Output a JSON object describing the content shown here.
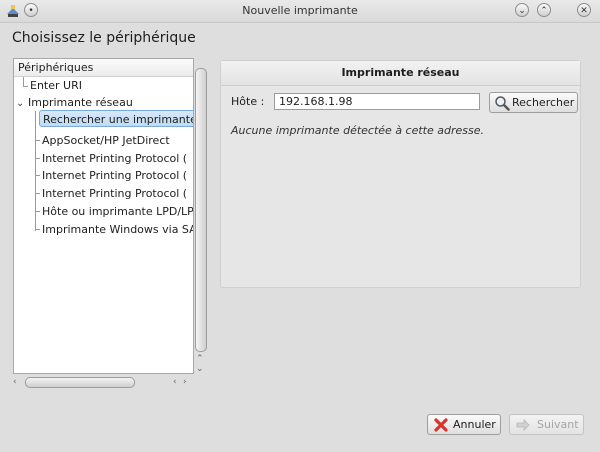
{
  "window": {
    "title": "Nouvelle imprimante",
    "minimize_icon": "chevron-down-icon",
    "maximize_icon": "chevron-up-icon",
    "close_icon": "close-icon"
  },
  "page": {
    "heading": "Choisissez le périphérique"
  },
  "tree": {
    "header": "Périphériques",
    "items": [
      {
        "label": "Enter URI",
        "level": 0
      },
      {
        "label": "Imprimante réseau",
        "level": 0,
        "expanded": true
      },
      {
        "label": "Rechercher une imprimante",
        "level": 1,
        "selected": true
      },
      {
        "label": "AppSocket/HP JetDirect",
        "level": 1
      },
      {
        "label": "Internet Printing Protocol (",
        "level": 1
      },
      {
        "label": "Internet Printing Protocol (",
        "level": 1
      },
      {
        "label": "Internet Printing Protocol (",
        "level": 1
      },
      {
        "label": "Hôte ou imprimante LPD/LP",
        "level": 1
      },
      {
        "label": "Imprimante Windows via SA",
        "level": 1
      }
    ]
  },
  "details": {
    "title": "Imprimante réseau",
    "host_label": "Hôte :",
    "host_value": "192.168.1.98",
    "search_button": "Rechercher",
    "notice": "Aucune imprimante détectée à cette adresse."
  },
  "footer": {
    "cancel_button": "Annuler",
    "next_button": "Suivant",
    "next_enabled": false
  },
  "colors": {
    "selection": "#c2dbf4",
    "cancel_icon": "#d9342b"
  }
}
